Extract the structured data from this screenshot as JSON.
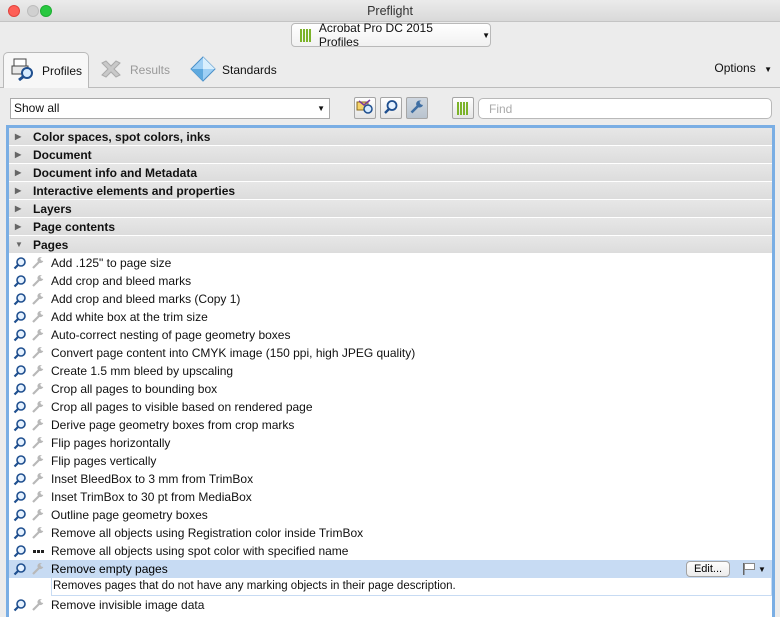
{
  "window": {
    "title": "Preflight"
  },
  "profile_selector": {
    "label": "Acrobat Pro DC 2015 Profiles"
  },
  "tabs": [
    {
      "label": "Profiles",
      "icon": "profiles-icon",
      "state": "active"
    },
    {
      "label": "Results",
      "icon": "results-icon",
      "state": "disabled"
    },
    {
      "label": "Standards",
      "icon": "standards-icon",
      "state": "normal"
    }
  ],
  "options_label": "Options",
  "toolbar": {
    "filter_value": "Show all",
    "find_placeholder": "Find"
  },
  "categories_collapsed": [
    "Color spaces, spot colors, inks",
    "Document",
    "Document info and Metadata",
    "Interactive elements and properties",
    "Layers",
    "Page contents"
  ],
  "expanded_category": "Pages",
  "fixups": [
    "Add .125\" to page size",
    "Add crop and bleed marks",
    "Add crop and bleed marks (Copy 1)",
    "Add white box at the trim size",
    "Auto-correct nesting of page geometry boxes",
    "Convert page content into CMYK image (150 ppi, high JPEG quality)",
    "Create 1.5 mm bleed by upscaling",
    "Crop all pages to bounding box",
    "Crop all pages to visible based on rendered page",
    "Derive page geometry boxes from crop marks",
    "Flip pages horizontally",
    "Flip pages vertically",
    "Inset BleedBox to 3 mm from TrimBox",
    "Inset TrimBox to 30 pt from MediaBox",
    "Outline page geometry boxes",
    "Remove all objects using Registration color inside TrimBox",
    "Remove all objects using spot color with specified name"
  ],
  "selected_fixup": {
    "label": "Remove empty pages",
    "edit_label": "Edit...",
    "description": "Removes pages that do not have any marking objects in their page description."
  },
  "after_selected": [
    "Remove invisible image data"
  ],
  "colors": {
    "accent": "#7aaee4",
    "selection": "#c7dbf3",
    "brand_green": "#7cb32a"
  }
}
